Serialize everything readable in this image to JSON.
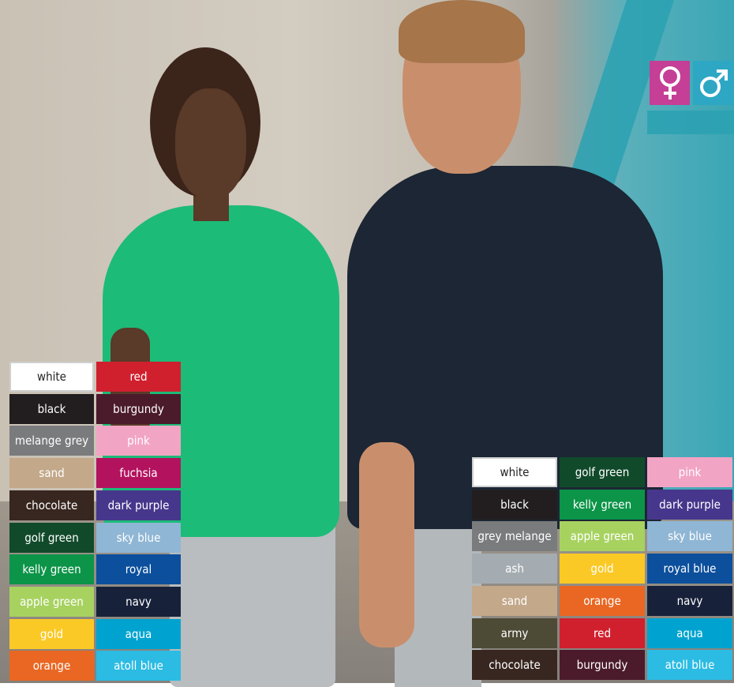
{
  "genders": {
    "female_icon": "female-symbol",
    "male_icon": "male-symbol",
    "female_color": "#c43f95",
    "male_color": "#2ea7c4"
  },
  "women_colors": [
    [
      {
        "label": "white",
        "color": "#ffffff"
      },
      {
        "label": "red",
        "color": "#d0202e"
      }
    ],
    [
      {
        "label": "black",
        "color": "#221e1f"
      },
      {
        "label": "burgundy",
        "color": "#4b1a2b"
      }
    ],
    [
      {
        "label": "melange grey",
        "color": "#7a7b7d"
      },
      {
        "label": "pink",
        "color": "#f2a4c4"
      }
    ],
    [
      {
        "label": "sand",
        "color": "#c3a88a"
      },
      {
        "label": "fuchsia",
        "color": "#b3125f"
      }
    ],
    [
      {
        "label": "chocolate",
        "color": "#382620"
      },
      {
        "label": "dark purple",
        "color": "#46378c"
      }
    ],
    [
      {
        "label": "golf green",
        "color": "#114a2b"
      },
      {
        "label": "sky blue",
        "color": "#8fb6d5"
      }
    ],
    [
      {
        "label": "kelly green",
        "color": "#0c9448"
      },
      {
        "label": "royal",
        "color": "#0c4f9c"
      }
    ],
    [
      {
        "label": "apple green",
        "color": "#a7d260"
      },
      {
        "label": "navy",
        "color": "#17213a"
      }
    ],
    [
      {
        "label": "gold",
        "color": "#fbc926"
      },
      {
        "label": "aqua",
        "color": "#00a3cf"
      }
    ],
    [
      {
        "label": "orange",
        "color": "#e96723"
      },
      {
        "label": "atoll blue",
        "color": "#2bbbe3"
      }
    ]
  ],
  "men_colors": [
    [
      {
        "label": "white",
        "color": "#ffffff"
      },
      {
        "label": "golf green",
        "color": "#114a2b"
      },
      {
        "label": "pink",
        "color": "#f2a4c4"
      }
    ],
    [
      {
        "label": "black",
        "color": "#221e1f"
      },
      {
        "label": "kelly green",
        "color": "#0c9448"
      },
      {
        "label": "dark purple",
        "color": "#46378c"
      }
    ],
    [
      {
        "label": "grey melange",
        "color": "#7a7b7d"
      },
      {
        "label": "apple green",
        "color": "#a7d260"
      },
      {
        "label": "sky blue",
        "color": "#8fb6d5"
      }
    ],
    [
      {
        "label": "ash",
        "color": "#a5acb1"
      },
      {
        "label": "gold",
        "color": "#fbc926"
      },
      {
        "label": "royal blue",
        "color": "#0c4f9c"
      }
    ],
    [
      {
        "label": "sand",
        "color": "#c3a88a"
      },
      {
        "label": "orange",
        "color": "#e96723"
      },
      {
        "label": "navy",
        "color": "#17213a"
      }
    ],
    [
      {
        "label": "army",
        "color": "#4d4a36"
      },
      {
        "label": "red",
        "color": "#d0202e"
      },
      {
        "label": "aqua",
        "color": "#00a3cf"
      }
    ],
    [
      {
        "label": "chocolate",
        "color": "#382620"
      },
      {
        "label": "burgundy",
        "color": "#4b1a2b"
      },
      {
        "label": "atoll blue",
        "color": "#2bbbe3"
      }
    ]
  ]
}
